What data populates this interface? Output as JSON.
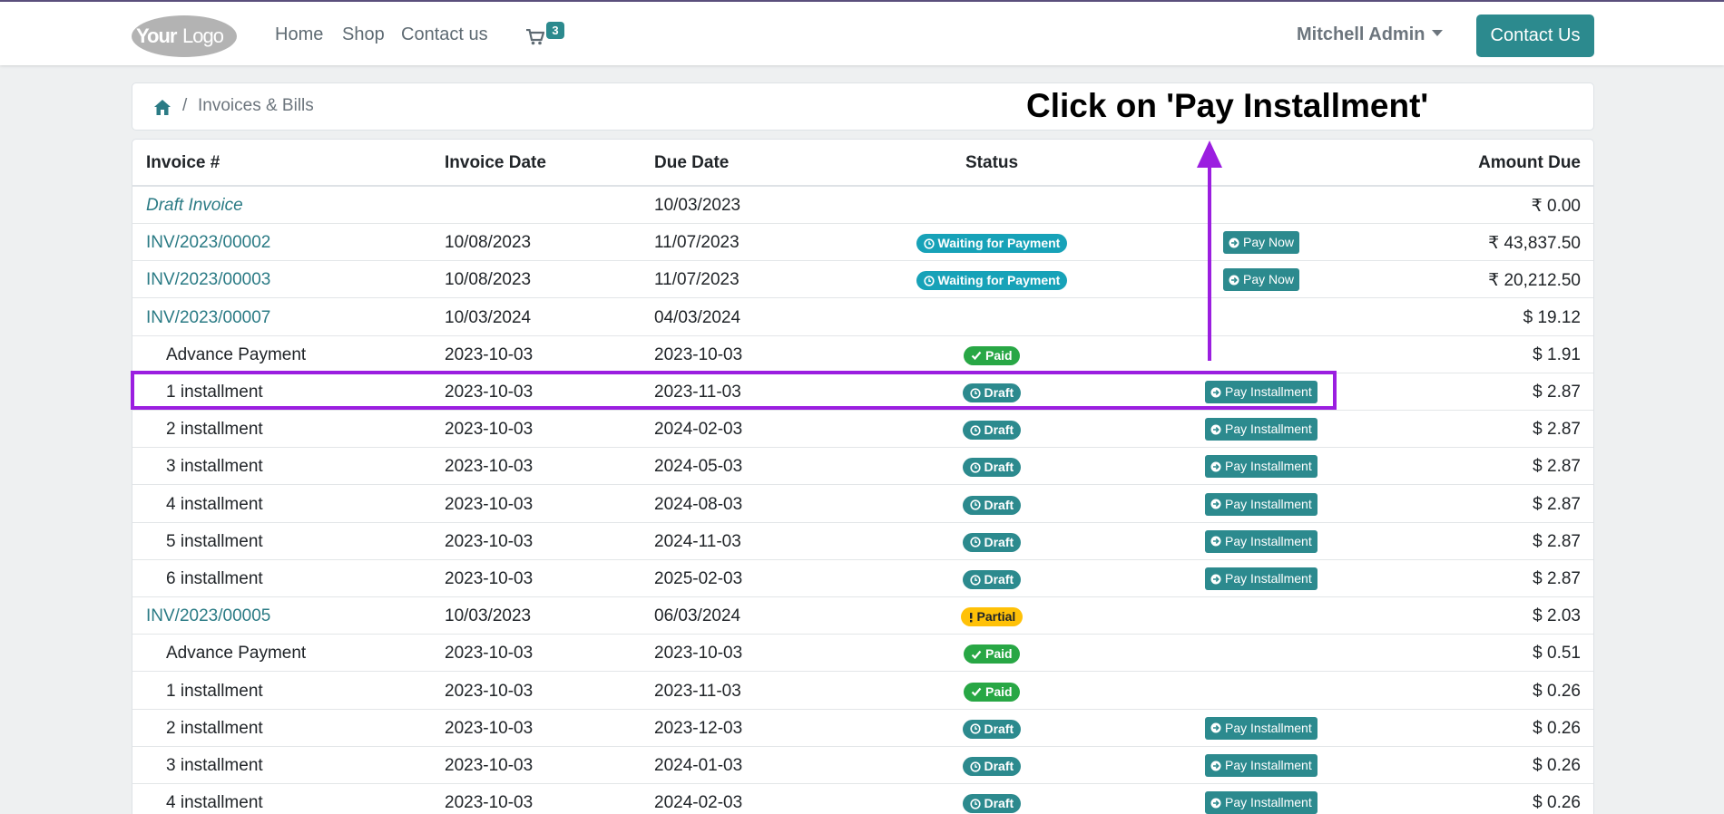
{
  "header": {
    "logo_text": "YourLogo",
    "nav": [
      {
        "label": "Home"
      },
      {
        "label": "Shop"
      },
      {
        "label": "Contact us"
      }
    ],
    "cart_count": "3",
    "user_name": "Mitchell Admin",
    "contact_button": "Contact Us"
  },
  "breadcrumb": {
    "separator": "/",
    "current": "Invoices & Bills"
  },
  "annotation": {
    "instruction": "Click on 'Pay Installment'",
    "color": "#9b1ee0"
  },
  "table": {
    "headers": {
      "invoice": "Invoice #",
      "invoice_date": "Invoice Date",
      "due_date": "Due Date",
      "status": "Status",
      "amount": "Amount Due"
    },
    "rows": [
      {
        "name": "Draft Invoice",
        "kind": "draft",
        "invoice_date": "",
        "due_date": "10/03/2023",
        "status": "",
        "action": "",
        "amount": "₹ 0.00"
      },
      {
        "name": "INV/2023/00002",
        "kind": "invoice",
        "invoice_date": "10/08/2023",
        "due_date": "11/07/2023",
        "status": "Waiting for Payment",
        "action": "Pay Now",
        "amount": "₹ 43,837.50"
      },
      {
        "name": "INV/2023/00003",
        "kind": "invoice",
        "invoice_date": "10/08/2023",
        "due_date": "11/07/2023",
        "status": "Waiting for Payment",
        "action": "Pay Now",
        "amount": "₹ 20,212.50"
      },
      {
        "name": "INV/2023/00007",
        "kind": "invoice",
        "invoice_date": "10/03/2024",
        "due_date": "04/03/2024",
        "status": "",
        "action": "",
        "amount": "$ 19.12"
      },
      {
        "name": "Advance Payment",
        "kind": "sub",
        "invoice_date": "2023-10-03",
        "due_date": "2023-10-03",
        "status": "Paid",
        "action": "",
        "amount": "$ 1.91"
      },
      {
        "name": "1 installment",
        "kind": "sub",
        "invoice_date": "2023-10-03",
        "due_date": "2023-11-03",
        "status": "Draft",
        "action": "Pay Installment",
        "amount": "$ 2.87"
      },
      {
        "name": "2 installment",
        "kind": "sub",
        "invoice_date": "2023-10-03",
        "due_date": "2024-02-03",
        "status": "Draft",
        "action": "Pay Installment",
        "amount": "$ 2.87"
      },
      {
        "name": "3 installment",
        "kind": "sub",
        "invoice_date": "2023-10-03",
        "due_date": "2024-05-03",
        "status": "Draft",
        "action": "Pay Installment",
        "amount": "$ 2.87"
      },
      {
        "name": "4 installment",
        "kind": "sub",
        "invoice_date": "2023-10-03",
        "due_date": "2024-08-03",
        "status": "Draft",
        "action": "Pay Installment",
        "amount": "$ 2.87"
      },
      {
        "name": "5 installment",
        "kind": "sub",
        "invoice_date": "2023-10-03",
        "due_date": "2024-11-03",
        "status": "Draft",
        "action": "Pay Installment",
        "amount": "$ 2.87"
      },
      {
        "name": "6 installment",
        "kind": "sub",
        "invoice_date": "2023-10-03",
        "due_date": "2025-02-03",
        "status": "Draft",
        "action": "Pay Installment",
        "amount": "$ 2.87"
      },
      {
        "name": "INV/2023/00005",
        "kind": "invoice",
        "invoice_date": "10/03/2023",
        "due_date": "06/03/2024",
        "status": "Partial",
        "action": "",
        "amount": "$ 2.03"
      },
      {
        "name": "Advance Payment",
        "kind": "sub",
        "invoice_date": "2023-10-03",
        "due_date": "2023-10-03",
        "status": "Paid",
        "action": "",
        "amount": "$ 0.51"
      },
      {
        "name": "1 installment",
        "kind": "sub",
        "invoice_date": "2023-10-03",
        "due_date": "2023-11-03",
        "status": "Paid",
        "action": "",
        "amount": "$ 0.26"
      },
      {
        "name": "2 installment",
        "kind": "sub",
        "invoice_date": "2023-10-03",
        "due_date": "2023-12-03",
        "status": "Draft",
        "action": "Pay Installment",
        "amount": "$ 0.26"
      },
      {
        "name": "3 installment",
        "kind": "sub",
        "invoice_date": "2023-10-03",
        "due_date": "2024-01-03",
        "status": "Draft",
        "action": "Pay Installment",
        "amount": "$ 0.26"
      },
      {
        "name": "4 installment",
        "kind": "sub",
        "invoice_date": "2023-10-03",
        "due_date": "2024-02-03",
        "status": "Draft",
        "action": "Pay Installment",
        "amount": "$ 0.26"
      }
    ]
  }
}
